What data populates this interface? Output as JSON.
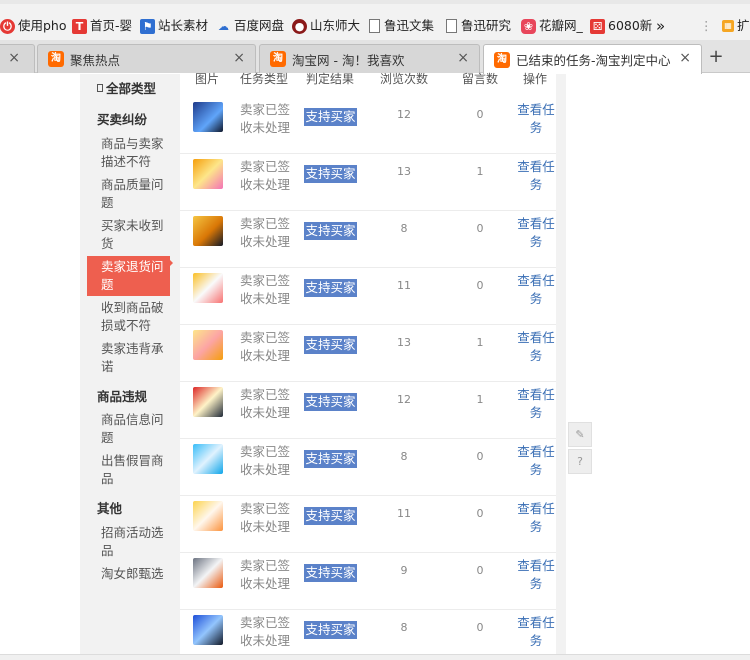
{
  "bookmarks": [
    {
      "label": "使用pho",
      "icon": "power-icon",
      "color": "#e53935"
    },
    {
      "label": "首页-婴",
      "icon": "t-logo-icon",
      "color": "#e53935"
    },
    {
      "label": "站长素材",
      "icon": "flag-icon",
      "color": "#2f6fd1"
    },
    {
      "label": "百度网盘",
      "icon": "cloud-icon",
      "color": "#2f6fd1"
    },
    {
      "label": "山东师大",
      "icon": "university-seal-icon",
      "color": "#8b1a1a"
    },
    {
      "label": "鲁迅文集",
      "icon": "document-icon",
      "color": "#777777"
    },
    {
      "label": "鲁迅研究",
      "icon": "document-icon",
      "color": "#777777"
    },
    {
      "label": "花瓣网_",
      "icon": "petal-icon",
      "color": "#e8465b"
    },
    {
      "label": "6080新",
      "icon": "gift-icon",
      "color": "#e53935"
    },
    {
      "label": "»",
      "icon": "more-bookmarks-icon",
      "color": "#555555"
    }
  ],
  "tabs": [
    {
      "label": "聚焦热点",
      "icon": "taobao-icon",
      "active": false
    },
    {
      "label": "淘宝网 - 淘！我喜欢",
      "icon": "taobao-icon",
      "active": false
    },
    {
      "label": "已结束的任务-淘宝判定中心",
      "icon": "taobao-icon",
      "active": true
    }
  ],
  "sidebar": {
    "title": "全部类型",
    "groups": [
      {
        "title": "买卖纠纷",
        "items": [
          "商品与卖家描述不符",
          "商品质量问题",
          "买家未收到货",
          "卖家退货问题",
          "收到商品破损或不符",
          "卖家违背承诺"
        ]
      },
      {
        "title": "商品违规",
        "items": [
          "商品信息问题",
          "出售假冒商品"
        ]
      },
      {
        "title": "其他",
        "items": [
          "招商活动选品",
          "淘女郎甄选"
        ]
      }
    ],
    "active_item": "卖家退货问题"
  },
  "table": {
    "headers": [
      "图片",
      "任务类型",
      "判定结果",
      "浏览次数",
      "留言数",
      "操作"
    ],
    "rows": [
      {
        "type": "卖家已签收未处理",
        "result": "支持买家",
        "views": "12",
        "messages": "0",
        "action": "查看任务"
      },
      {
        "type": "卖家已签收未处理",
        "result": "支持买家",
        "views": "13",
        "messages": "1",
        "action": "查看任务"
      },
      {
        "type": "卖家已签收未处理",
        "result": "支持买家",
        "views": "8",
        "messages": "0",
        "action": "查看任务"
      },
      {
        "type": "卖家已签收未处理",
        "result": "支持买家",
        "views": "11",
        "messages": "0",
        "action": "查看任务"
      },
      {
        "type": "卖家已签收未处理",
        "result": "支持买家",
        "views": "13",
        "messages": "1",
        "action": "查看任务"
      },
      {
        "type": "卖家已签收未处理",
        "result": "支持买家",
        "views": "12",
        "messages": "1",
        "action": "查看任务"
      },
      {
        "type": "卖家已签收未处理",
        "result": "支持买家",
        "views": "8",
        "messages": "0",
        "action": "查看任务"
      },
      {
        "type": "卖家已签收未处理",
        "result": "支持买家",
        "views": "11",
        "messages": "0",
        "action": "查看任务"
      },
      {
        "type": "卖家已签收未处理",
        "result": "支持买家",
        "views": "9",
        "messages": "0",
        "action": "查看任务"
      },
      {
        "type": "卖家已签收未处理",
        "result": "支持买家",
        "views": "8",
        "messages": "0",
        "action": "查看任务"
      }
    ]
  },
  "float_tools": [
    {
      "icon": "edit-pencil-icon",
      "glyph": "✎"
    },
    {
      "icon": "help-question-icon",
      "glyph": "?"
    }
  ],
  "colors": {
    "accent": "#ee5f4f",
    "result_badge": "#5b82c9",
    "link": "#3b6fb5"
  }
}
